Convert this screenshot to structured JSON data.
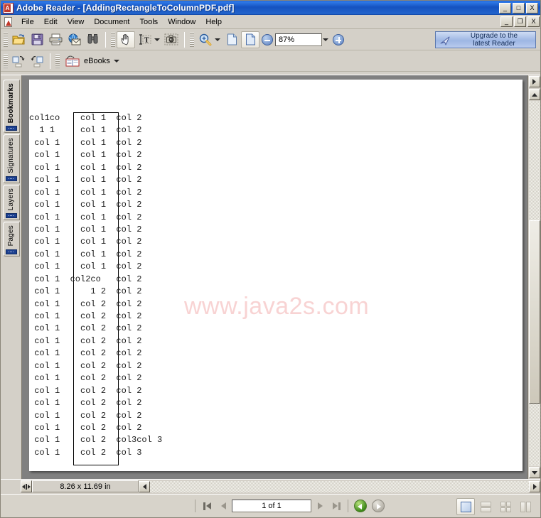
{
  "window": {
    "app_icon": "adobe-reader-icon",
    "title": "Adobe Reader - [AddingRectangleToColumnPDF.pdf]",
    "outer_controls": {
      "minimize": "_",
      "maximize": "□",
      "close": "X"
    },
    "mdi_controls": {
      "minimize": "_",
      "restore": "❐",
      "close": "X"
    }
  },
  "menubar": {
    "doc_icon": "pdf-document-icon",
    "items": [
      {
        "label": "File"
      },
      {
        "label": "Edit"
      },
      {
        "label": "View"
      },
      {
        "label": "Document"
      },
      {
        "label": "Tools"
      },
      {
        "label": "Window"
      },
      {
        "label": "Help"
      }
    ]
  },
  "toolbar": {
    "file_group": [
      {
        "name": "open-file-icon",
        "tip": "Open"
      },
      {
        "name": "save-file-icon",
        "tip": "Save a Copy"
      },
      {
        "name": "print-icon",
        "tip": "Print"
      },
      {
        "name": "email-icon",
        "tip": "Email"
      },
      {
        "name": "search-binoculars-icon",
        "tip": "Search"
      }
    ],
    "select_group": [
      {
        "name": "hand-tool-icon",
        "tip": "Hand Tool",
        "selected": true
      },
      {
        "name": "select-text-icon",
        "tip": "Select Text"
      },
      {
        "name": "snapshot-camera-icon",
        "tip": "Snapshot Tool"
      }
    ],
    "zoom_group": [
      {
        "name": "zoom-in-magnifier-icon",
        "tip": "Zoom In Tool"
      },
      {
        "name": "actual-size-page-icon",
        "tip": "Actual Size"
      },
      {
        "name": "fit-page-icon",
        "tip": "Fit Page",
        "selected": true
      }
    ],
    "zoom_out_label": "−",
    "zoom_value": "87%",
    "zoom_in_label": "+",
    "upgrade": {
      "icon": "upgrade-arrow-icon",
      "line1": "Upgrade to the",
      "line2": "latest Reader"
    },
    "row2": {
      "rotate_cw_icon": "rotate-clockwise-icon",
      "rotate_ccw_icon": "rotate-counterclockwise-icon",
      "ebooks_icon": "ebooks-icon",
      "ebooks_label": "eBooks"
    }
  },
  "navpanel": {
    "tabs": [
      {
        "label": "Bookmarks",
        "active": true
      },
      {
        "label": "Signatures",
        "active": false
      },
      {
        "label": "Layers",
        "active": false
      },
      {
        "label": "Pages",
        "active": false
      }
    ]
  },
  "document": {
    "watermark": "www.java2s.com",
    "lines": [
      "col1co    col 1  col 2",
      "  1 1     col 1  col 2",
      " col 1    col 1  col 2",
      " col 1    col 1  col 2",
      " col 1    col 1  col 2",
      " col 1    col 1  col 2",
      " col 1    col 1  col 2",
      " col 1    col 1  col 2",
      " col 1    col 1  col 2",
      " col 1    col 1  col 2",
      " col 1    col 1  col 2",
      " col 1    col 1  col 2",
      " col 1    col 1  col 2",
      " col 1  col2co   col 2",
      " col 1      1 2  col 2",
      " col 1    col 2  col 2",
      " col 1    col 2  col 2",
      " col 1    col 2  col 2",
      " col 1    col 2  col 2",
      " col 1    col 2  col 2",
      " col 1    col 2  col 2",
      " col 1    col 2  col 2",
      " col 1    col 2  col 2",
      " col 1    col 2  col 2",
      " col 1    col 2  col 2",
      " col 1    col 2  col 2",
      " col 1    col 2  col3col 3",
      " col 1    col 2  col 3"
    ]
  },
  "scrollbars": {
    "v_top_extra_icon": "split-view-right-arrow-icon",
    "v_up_icon": "scroll-up-arrow-icon",
    "v_down_icon": "scroll-down-arrow-icon",
    "h_left_icon": "scroll-left-arrow-icon",
    "h_right_icon": "split-view-right-arrow-icon"
  },
  "statusstrip": {
    "resize_grip": "pane-resize-grip-icon",
    "page_size": "8.26 x 11.69 in"
  },
  "statusbar": {
    "first_page_icon": "first-page-icon",
    "prev_page_icon": "previous-page-icon",
    "page_indicator": "1 of 1",
    "next_page_icon": "next-page-icon",
    "last_page_icon": "last-page-icon",
    "back_icon": "previous-view-icon",
    "forward_icon": "next-view-icon",
    "layout_buttons": [
      {
        "name": "single-page-layout-button",
        "selected": true
      },
      {
        "name": "continuous-layout-button",
        "selected": false
      },
      {
        "name": "continuous-facing-layout-button",
        "selected": false
      },
      {
        "name": "facing-layout-button",
        "selected": false
      }
    ]
  },
  "colors": {
    "titlebar_blue": "#1552c0",
    "chrome_grey": "#d4d0c8",
    "viewport_grey": "#808080",
    "watermark_pink": "#f8d3d3",
    "page_white": "#ffffff"
  }
}
